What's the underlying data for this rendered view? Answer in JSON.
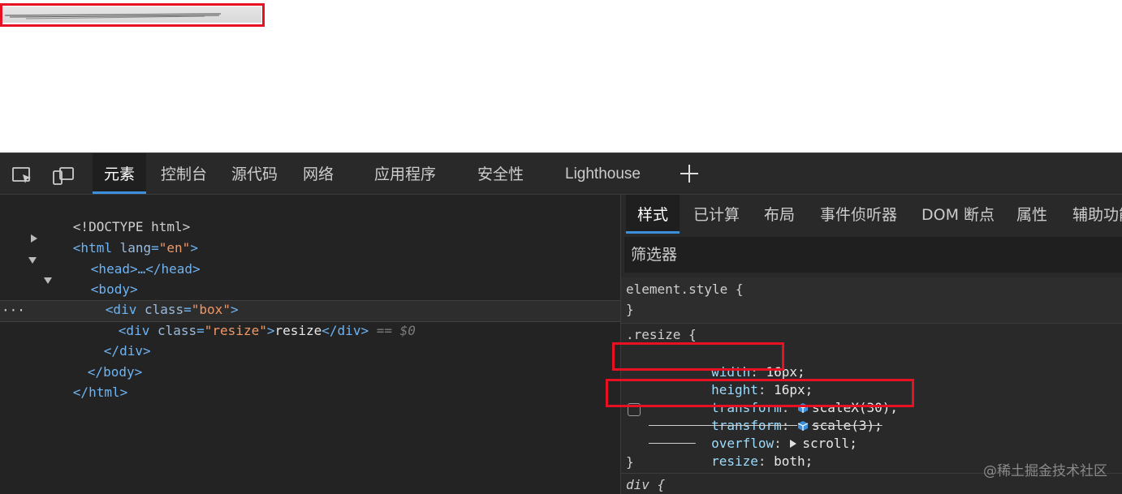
{
  "toolbar": {
    "tabs": [
      "元素",
      "控制台",
      "源代码",
      "网络",
      "应用程序",
      "安全性",
      "Lighthouse"
    ],
    "icons": [
      "inspect-icon",
      "device-toggle-icon",
      "add-tab-icon"
    ]
  },
  "elements": {
    "lines": [
      "<!DOCTYPE html>",
      "<html lang=\"en\">",
      "<head>…</head>",
      "<body>",
      "<div class=\"box\">",
      "<div class=\"resize\">resize</div>",
      "</div>",
      "</body>",
      "</html>"
    ],
    "doctype": "<!DOCTYPE html>",
    "html_open_tag": "<html",
    "html_lang_attr": "lang",
    "html_lang_val": "\"en\"",
    "head": "<head>…</head>",
    "body_open": "<body>",
    "box_tag": "<div",
    "box_attr": "class",
    "box_val": "\"box\"",
    "resize_tag": "<div",
    "resize_attr": "class",
    "resize_val": "\"resize\"",
    "resize_text": "resize",
    "resize_close": "</div>",
    "selected_marker": "== $0",
    "div_close": "</div>",
    "body_close": "</body>",
    "html_close": "</html>",
    "ellipsis": "···"
  },
  "styles": {
    "tabs": [
      "样式",
      "已计算",
      "布局",
      "事件侦听器",
      "DOM 断点",
      "属性",
      "辅助功能"
    ],
    "filter_placeholder": "筛选器",
    "element_style_selector": "element.style {",
    "element_style_close": "}",
    "resize_selector": ".resize {",
    "declarations": [
      {
        "name": "width",
        "value": "16px;"
      },
      {
        "name": "height",
        "value": "16px;"
      },
      {
        "name": "transform",
        "value": "scaleX(30);"
      },
      {
        "name": "transform",
        "value": "scale(3);"
      },
      {
        "name": "overflow",
        "value": "scroll;"
      },
      {
        "name": "resize",
        "value": "both;"
      }
    ],
    "resize_close": "}",
    "next_selector": "div {"
  },
  "watermark": "@稀土掘金技术社区",
  "colors": {
    "accent": "#3b8fdc",
    "highlight_red": "#e81123",
    "tag": "#6fb3f2",
    "attr_value": "#f29766"
  }
}
